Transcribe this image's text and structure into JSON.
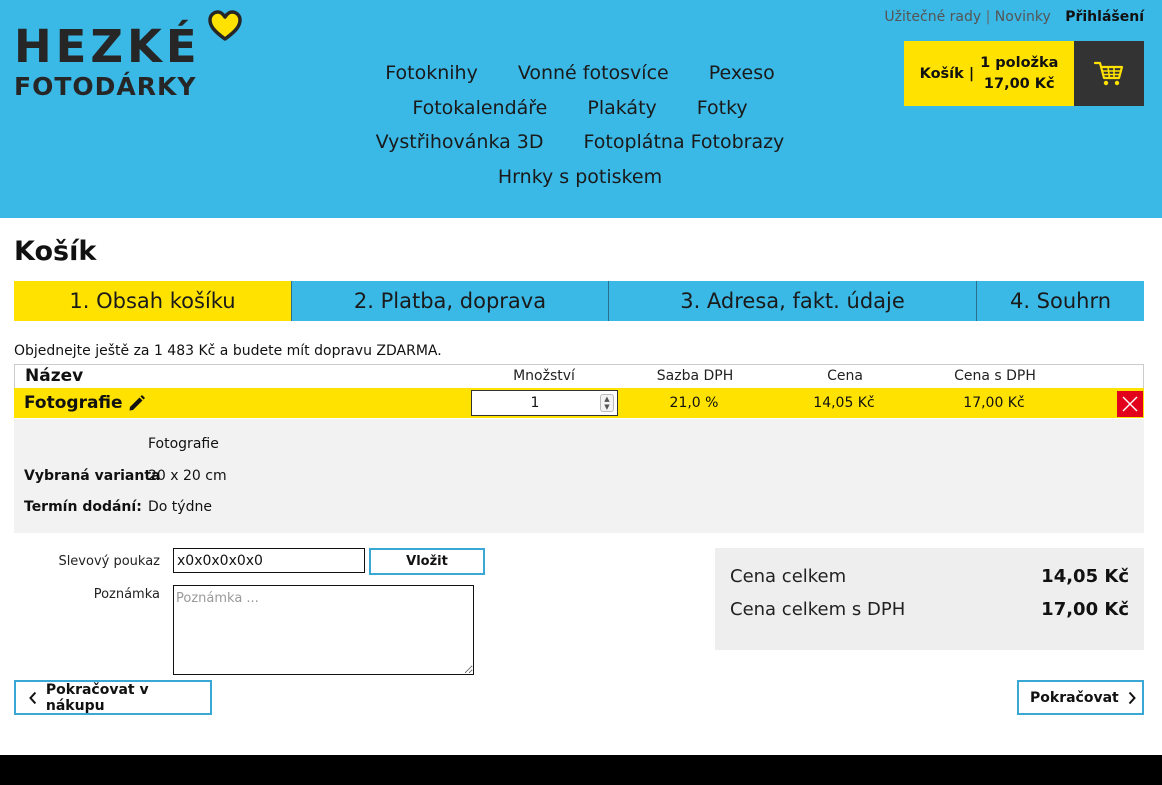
{
  "logo": {
    "line1": "HEZKÉ",
    "line2": "FOTODÁRKY"
  },
  "top_links": {
    "tips": "Užitečné rady",
    "separator": "|",
    "news": "Novinky",
    "login": "Přihlášení"
  },
  "nav": {
    "rows": [
      [
        "Fotoknihy",
        "Vonné fotosvíce",
        "Pexeso"
      ],
      [
        "Fotokalendáře",
        "Plakáty",
        "Fotky"
      ],
      [
        "Vystřihovánka 3D",
        "Fotoplátna Fotobrazy"
      ],
      [
        "Hrnky s potiskem"
      ]
    ]
  },
  "cart": {
    "title": "Košík |",
    "count": "1 položka",
    "total": "17,00 Kč"
  },
  "page_title": "Košík",
  "steps": [
    "1. Obsah košíku",
    "2. Platba, doprava",
    "3. Adresa, fakt. údaje",
    "4. Souhrn"
  ],
  "free_shipping": "Objednejte ještě za 1 483 Kč a budete mít dopravu ZDARMA.",
  "table": {
    "headers": {
      "name": "Název",
      "qty": "Množství",
      "vat": "Sazba DPH",
      "price": "Cena",
      "price_vat": "Cena s DPH"
    },
    "item": {
      "name": "Fotografie",
      "qty": "1",
      "vat": "21,0 %",
      "price": "14,05 Kč",
      "price_vat": "17,00 Kč"
    }
  },
  "details": {
    "product": "Fotografie",
    "variant_label": "Vybraná varianta",
    "variant_value": "20 x 20 cm",
    "delivery_label": "Termín dodání:",
    "delivery_value": "Do týdne"
  },
  "coupon": {
    "label": "Slevový poukaz",
    "value": "x0x0x0x0x0",
    "button": "Vložit"
  },
  "note": {
    "label": "Poznámka",
    "placeholder": "Poznámka ..."
  },
  "summary": {
    "total_label": "Cena celkem",
    "total_value": "14,05 Kč",
    "total_vat_label": "Cena celkem s DPH",
    "total_vat_value": "17,00 Kč"
  },
  "buttons": {
    "back": "Pokračovat v nákupu",
    "next": "Pokračovat"
  },
  "colors": {
    "header_blue": "#3ab8e6",
    "accent_yellow": "#ffe200",
    "delete_red": "#e3001b",
    "dark": "#333333"
  },
  "icons": {
    "heart": "heart-icon",
    "cart": "cart-icon",
    "edit": "pencil-icon",
    "delete": "close-icon",
    "back": "chevron-left-icon",
    "next": "chevron-right-icon"
  }
}
